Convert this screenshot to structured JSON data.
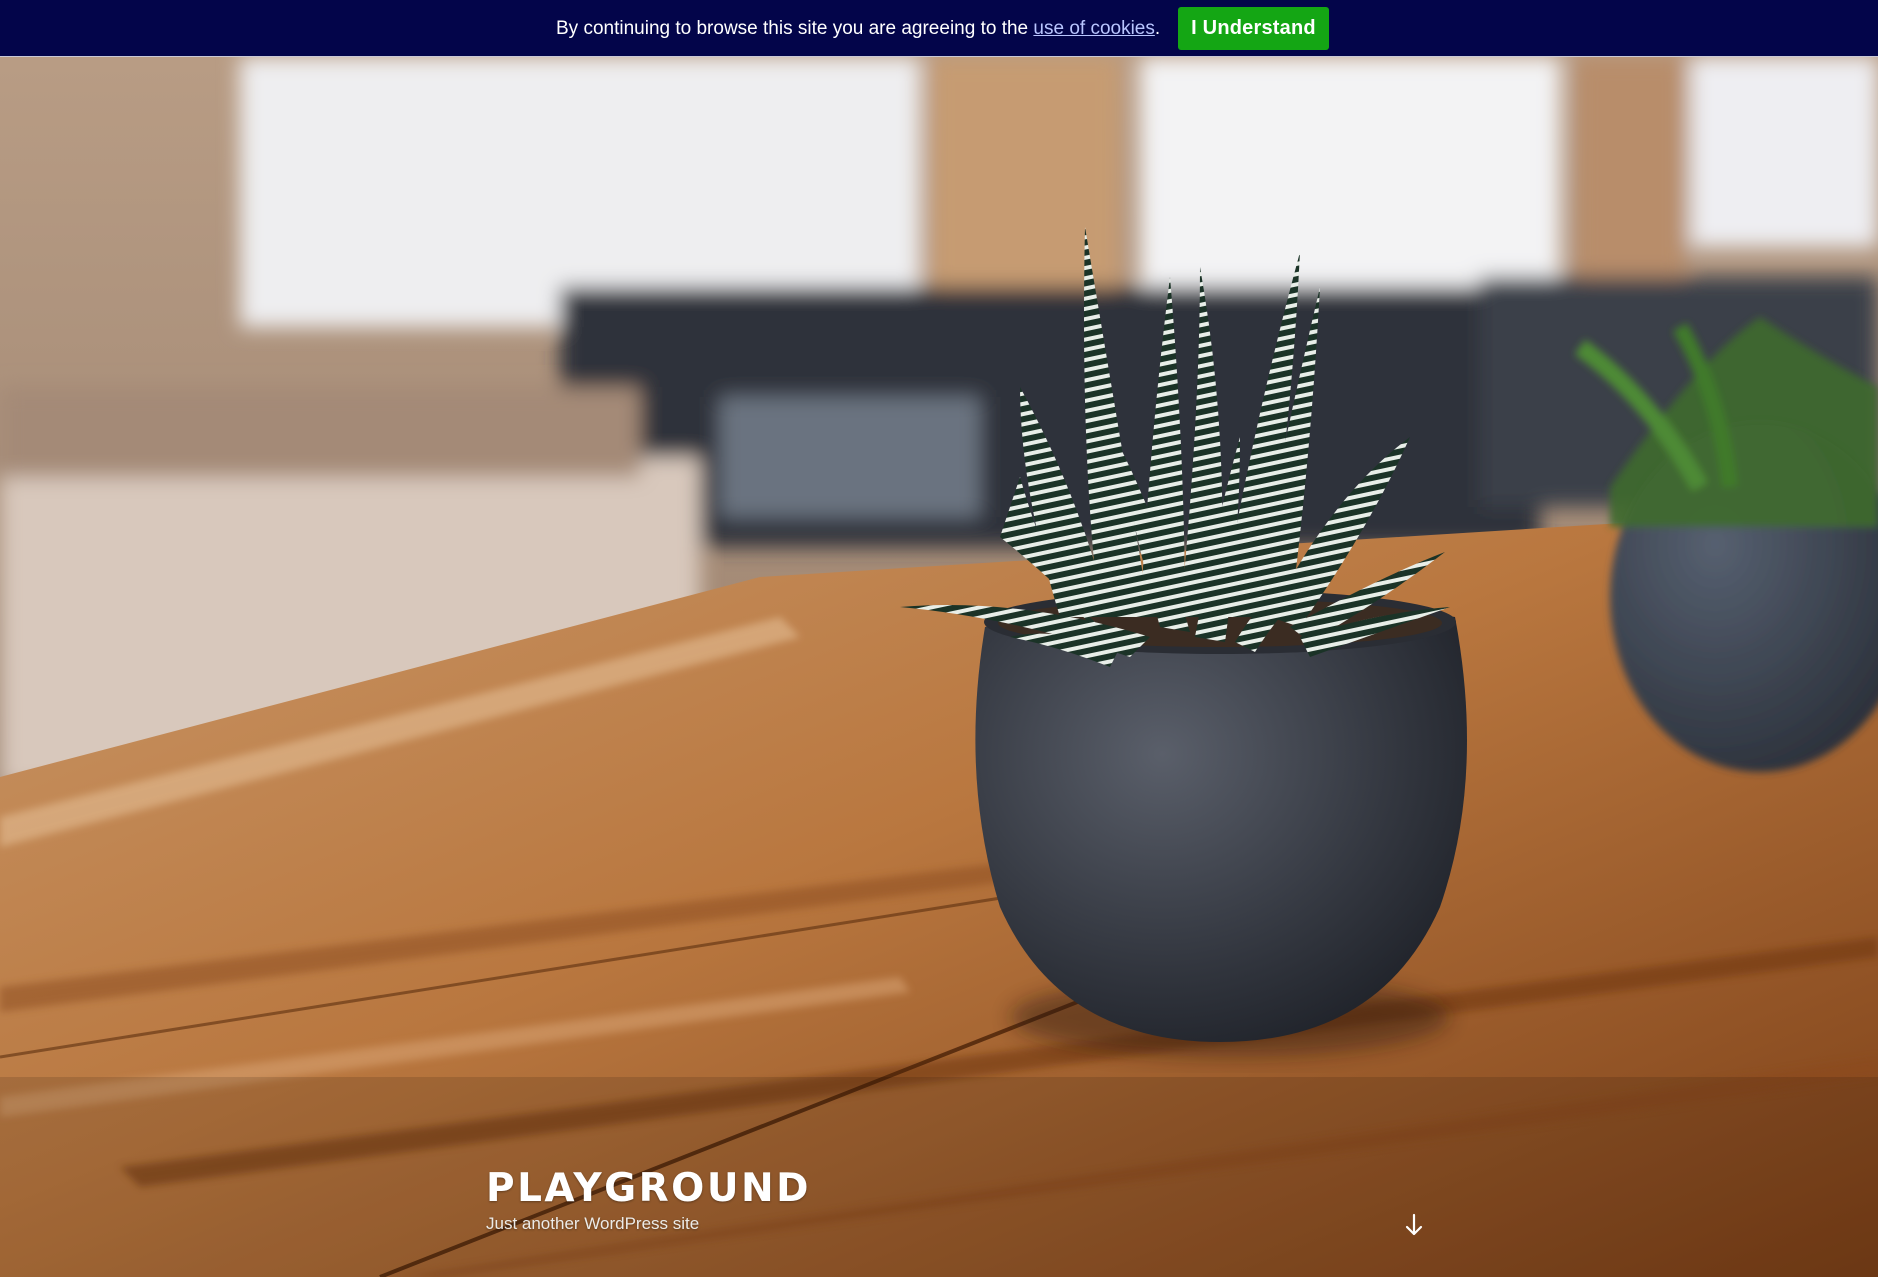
{
  "cookie_bar": {
    "message": "By continuing to browse this site you are agreeing to the ",
    "link_text": "use of cookies",
    "suffix": ".",
    "button_label": "I Understand",
    "background": "#03054a",
    "button_color": "#14a614"
  },
  "header": {
    "site_title": "PLAYGROUND",
    "site_description": "Just another WordPress site",
    "scroll_icon": "arrow-down-icon"
  },
  "hero_image": {
    "subject": "potted-succulent-photo"
  }
}
